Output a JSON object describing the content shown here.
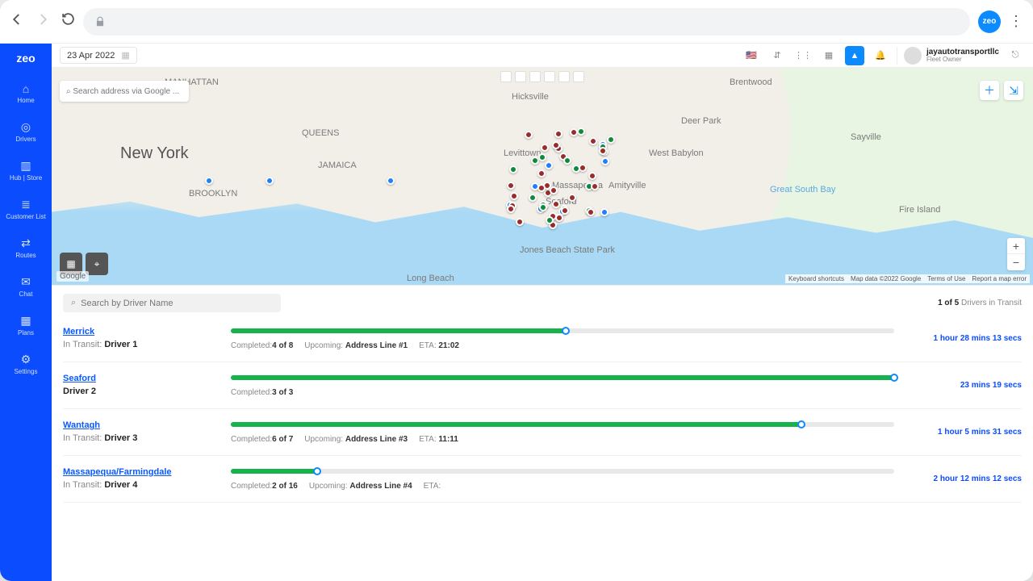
{
  "browser": {
    "logo_text": "zeo"
  },
  "header": {
    "date": "23 Apr 2022",
    "user_name": "jayautotransportllc",
    "user_role": "Fleet Owner"
  },
  "sidebar": {
    "logo": "zeo",
    "items": [
      {
        "label": "Home"
      },
      {
        "label": "Drivers"
      },
      {
        "label": "Hub | Store"
      },
      {
        "label": "Customer List"
      },
      {
        "label": "Routes"
      },
      {
        "label": "Chat"
      },
      {
        "label": "Plans"
      },
      {
        "label": "Settings"
      }
    ]
  },
  "map": {
    "search_placeholder": "Search address via Google ...",
    "center_label": "New York",
    "labels": [
      "MANHATTAN",
      "BROOKLYN",
      "QUEENS",
      "JAMAICA",
      "Long Beach",
      "Hicksville",
      "Levittown",
      "Seaford",
      "Massapequa",
      "Amityville",
      "Brentwood",
      "West Babylon",
      "Deer Park",
      "Sayville",
      "Fire Island",
      "Great South Bay",
      "Jones Beach State Park"
    ],
    "credit_shortcuts": "Keyboard shortcuts",
    "credit_data": "Map data ©2022 Google",
    "credit_terms": "Terms of Use",
    "credit_report": "Report a map error"
  },
  "driver_panel": {
    "search_placeholder": "Search by Driver Name",
    "count_bold": "1 of 5",
    "count_text": " Drivers in Transit"
  },
  "drivers": [
    {
      "route": "Merrick",
      "status_label": "In Transit:",
      "driver": "Driver 1",
      "completed_label": "Completed:",
      "completed_val": "4 of 8",
      "upcoming_label": "Upcoming:",
      "upcoming_val": "Address Line #1",
      "eta_label": "ETA:",
      "eta": "21:02",
      "progress_pct": 50.5,
      "time_remaining": "1 hour 28 mins 13 secs"
    },
    {
      "route": "Seaford",
      "status_label": "",
      "driver": "Driver 2",
      "completed_label": "Completed:",
      "completed_val": "3 of 3",
      "upcoming_label": "",
      "upcoming_val": "",
      "eta_label": "",
      "eta": "",
      "progress_pct": 100,
      "time_remaining": "23 mins 19 secs"
    },
    {
      "route": "Wantagh",
      "status_label": "In Transit:",
      "driver": "Driver 3",
      "completed_label": "Completed:",
      "completed_val": "6 of 7",
      "upcoming_label": "Upcoming:",
      "upcoming_val": "Address Line #3",
      "eta_label": "ETA:",
      "eta": "11:11",
      "progress_pct": 86,
      "time_remaining": "1 hour 5 mins 31 secs"
    },
    {
      "route": "Massapequa/Farmingdale",
      "status_label": "In Transit:",
      "driver": "Driver 4",
      "completed_label": "Completed:",
      "completed_val": "2 of 16",
      "upcoming_label": "Upcoming:",
      "upcoming_val": "Address Line #4",
      "eta_label": "ETA:",
      "eta": "",
      "progress_pct": 13,
      "time_remaining": "2 hour 12 mins 12 secs"
    }
  ]
}
